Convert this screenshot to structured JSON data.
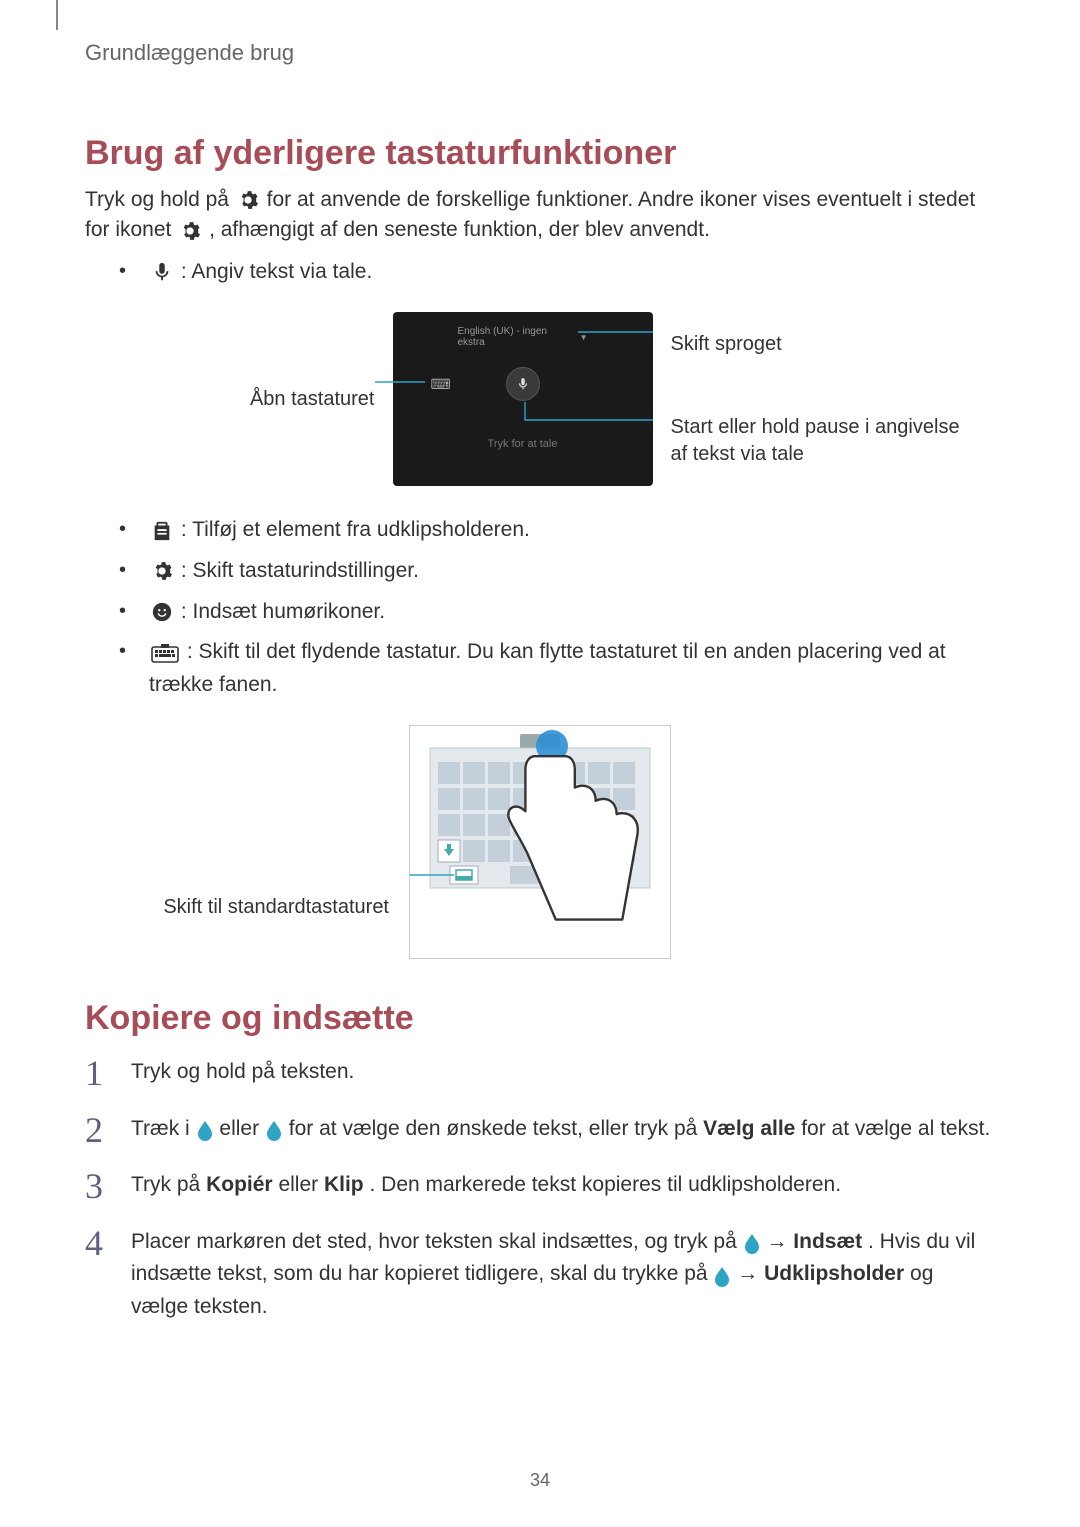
{
  "chapter": "Grundlæggende brug",
  "section1": {
    "title": "Brug af yderligere tastaturfunktioner",
    "intro_a": "Tryk og hold på ",
    "intro_b": " for at anvende de forskellige funktioner. Andre ikoner vises eventuelt i stedet for ikonet ",
    "intro_c": ", afhængigt af den seneste funktion, der blev anvendt.",
    "b1": " : Angiv tekst via tale.",
    "fig1": {
      "left": "Åbn tastaturet",
      "right_top": "Skift sproget",
      "right_bottom": "Start eller hold pause i angivelse af tekst via tale",
      "lang": "English (UK) - ingen ekstra",
      "hint": "Tryk for at tale"
    },
    "b2": " : Tilføj et element fra udklipsholderen.",
    "b3": " : Skift tastaturindstillinger.",
    "b4": " : Indsæt humørikoner.",
    "b5": " : Skift til det flydende tastatur. Du kan flytte tastaturet til en anden placering ved at trække fanen.",
    "fig2_left": "Skift til standardtastaturet"
  },
  "section2": {
    "title": "Kopiere og indsætte",
    "s1": "Tryk og hold på teksten.",
    "s2_a": "Træk i ",
    "s2_b": " eller ",
    "s2_c": " for at vælge den ønskede tekst, eller tryk på ",
    "s2_d": "Vælg alle",
    "s2_e": " for at vælge al tekst.",
    "s3_a": "Tryk på ",
    "s3_b": "Kopiér",
    "s3_c": " eller ",
    "s3_d": "Klip",
    "s3_e": ". Den markerede tekst kopieres til udklipsholderen.",
    "s4_a": "Placer markøren det sted, hvor teksten skal indsættes, og tryk på ",
    "s4_b": " → ",
    "s4_c": "Indsæt",
    "s4_d": ". Hvis du vil indsætte tekst, som du har kopieret tidligere, skal du trykke på ",
    "s4_e": " → ",
    "s4_f": "Udklipsholder",
    "s4_g": " og vælge teksten."
  },
  "page_number": "34"
}
